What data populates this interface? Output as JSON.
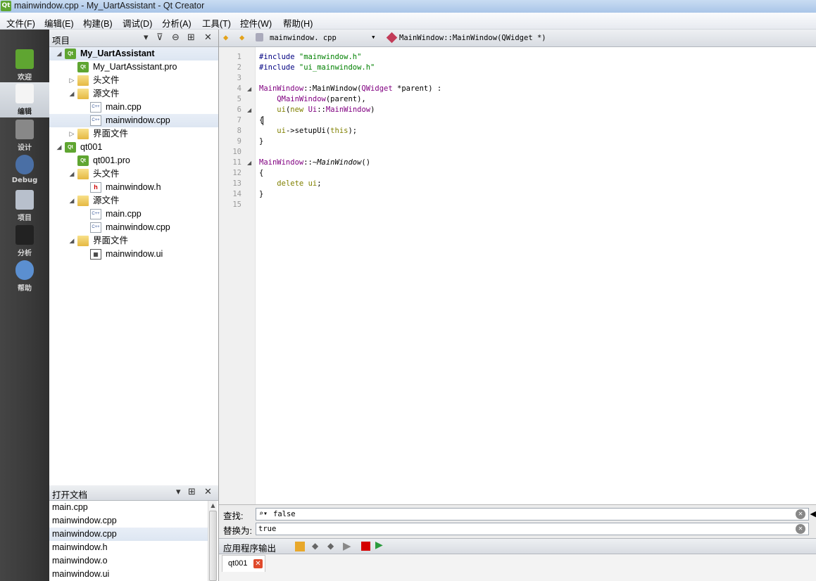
{
  "window": {
    "title": "mainwindow.cpp - My_UartAssistant - Qt Creator",
    "icon": "qt-logo-icon"
  },
  "menu": [
    "文件(F)",
    "编辑(E)",
    "构建(B)",
    "调试(D)",
    "分析(A)",
    "工具(T)",
    "控件(W)",
    "帮助(H)"
  ],
  "modes": [
    {
      "label": "欢迎",
      "icon": "qt-welcome-icon"
    },
    {
      "label": "编辑",
      "icon": "edit-document-icon",
      "active": true
    },
    {
      "label": "设计",
      "icon": "design-tools-icon"
    },
    {
      "label": "Debug",
      "icon": "debug-bug-icon"
    },
    {
      "label": "项目",
      "icon": "project-wrench-icon"
    },
    {
      "label": "分析",
      "icon": "analyze-screen-icon"
    },
    {
      "label": "帮助",
      "icon": "help-question-icon"
    }
  ],
  "projects_pane": {
    "title": "项目"
  },
  "tree": [
    {
      "text": "My_UartAssistant",
      "bold": true,
      "icon": "qt-project",
      "indent": 0,
      "arrow": "▲",
      "selected": true
    },
    {
      "text": "My_UartAssistant.pro",
      "icon": "qt-pro",
      "indent": 1,
      "arrow": ""
    },
    {
      "text": "头文件",
      "icon": "folder-h",
      "indent": 1,
      "arrow": "▷"
    },
    {
      "text": "源文件",
      "icon": "folder-cpp",
      "indent": 1,
      "arrow": "◢"
    },
    {
      "text": "main.cpp",
      "icon": "cpp",
      "indent": 2,
      "arrow": ""
    },
    {
      "text": "mainwindow.cpp",
      "icon": "cpp",
      "indent": 2,
      "arrow": "",
      "selected": true
    },
    {
      "text": "界面文件",
      "icon": "folder-ui",
      "indent": 1,
      "arrow": "▷"
    },
    {
      "text": "qt001",
      "icon": "qt-project",
      "indent": 0,
      "arrow": "◢"
    },
    {
      "text": "qt001.pro",
      "icon": "qt-pro",
      "indent": 1,
      "arrow": ""
    },
    {
      "text": "头文件",
      "icon": "folder-h",
      "indent": 1,
      "arrow": "◢"
    },
    {
      "text": "mainwindow.h",
      "icon": "h",
      "indent": 2,
      "arrow": ""
    },
    {
      "text": "源文件",
      "icon": "folder-cpp",
      "indent": 1,
      "arrow": "◢"
    },
    {
      "text": "main.cpp",
      "icon": "cpp",
      "indent": 2,
      "arrow": ""
    },
    {
      "text": "mainwindow.cpp",
      "icon": "cpp",
      "indent": 2,
      "arrow": ""
    },
    {
      "text": "界面文件",
      "icon": "folder-ui",
      "indent": 1,
      "arrow": "◢"
    },
    {
      "text": "mainwindow.ui",
      "icon": "ui",
      "indent": 2,
      "arrow": ""
    }
  ],
  "open_docs": {
    "title": "打开文档",
    "items": [
      {
        "text": "main.cpp"
      },
      {
        "text": "mainwindow.cpp"
      },
      {
        "text": "mainwindow.cpp",
        "selected": true
      },
      {
        "text": "mainwindow.h"
      },
      {
        "text": "mainwindow.o"
      },
      {
        "text": "mainwindow.ui"
      }
    ]
  },
  "editor": {
    "file": "mainwindow. cpp",
    "symbol": "MainWindow::MainWindow(QWidget *)",
    "lines": [
      {
        "n": "1",
        "html": "<span class='pp'>#include</span> <span class='st'>\"mainwindow.h\"</span>"
      },
      {
        "n": "2",
        "html": "<span class='pp'>#include</span> <span class='st'>\"ui_mainwindow.h\"</span>"
      },
      {
        "n": "3",
        "html": ""
      },
      {
        "n": "4",
        "html": "<span class='ty'>MainWindow</span>::MainWindow(<span class='ty'>QWidget</span> *parent) :",
        "fold": "◢"
      },
      {
        "n": "5",
        "html": "    <span class='ty'>QMainWindow</span>(parent),"
      },
      {
        "n": "6",
        "html": "    <span class='kw'>ui</span>(<span class='kw'>new</span> <span class='ty'>Ui</span>::<span class='ty'>MainWindow</span>)",
        "fold": "◢"
      },
      {
        "n": "7",
        "html": "{"
      },
      {
        "n": "8",
        "html": "    <span class='kw'>ui</span>-&gt;setupUi(<span class='kw'>this</span>);"
      },
      {
        "n": "9",
        "html": "}"
      },
      {
        "n": "10",
        "html": ""
      },
      {
        "n": "11",
        "html": "<span class='ty'>MainWindow</span>::~<span class='it2'>MainWindow</span>()",
        "fold": "◢"
      },
      {
        "n": "12",
        "html": "{"
      },
      {
        "n": "13",
        "html": "    <span class='kw'>delete</span> <span class='kw'>ui</span>;"
      },
      {
        "n": "14",
        "html": "}"
      },
      {
        "n": "15",
        "html": ""
      }
    ]
  },
  "find": {
    "find_label": "查找:",
    "find_value": "false",
    "replace_label": "替换为:",
    "replace_value": "true"
  },
  "output": {
    "title": "应用程序输出",
    "tab": "qt001"
  }
}
